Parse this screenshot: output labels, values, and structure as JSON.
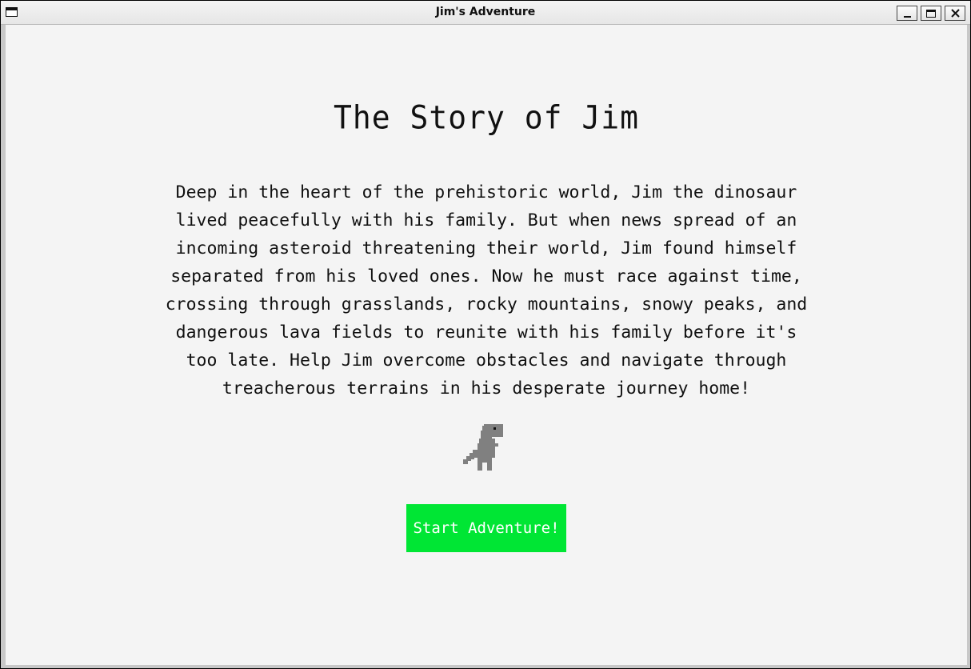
{
  "window": {
    "title": "Jim's Adventure",
    "buttons": {
      "minimize": "_",
      "maximize": "□",
      "close": "✕"
    }
  },
  "story": {
    "title": "The Story of Jim",
    "text": "Deep in the heart of the prehistoric world, Jim the dinosaur lived peacefully with his family. But when news spread of an incoming asteroid threatening their world, Jim found himself separated from his loved ones. Now he must race against time, crossing through grasslands, rocky mountains, snowy peaks, and dangerous lava fields to reunite with his family before it's too late. Help Jim overcome obstacles and navigate through treacherous terrains in his desperate journey home!"
  },
  "start_button": {
    "label": "Start Adventure!"
  },
  "colors": {
    "background": "#f4f4f4",
    "button": "#00e634",
    "dino": "#808080"
  },
  "icons": {
    "app": "window-icon",
    "dino": "pixel-dinosaur-icon"
  }
}
